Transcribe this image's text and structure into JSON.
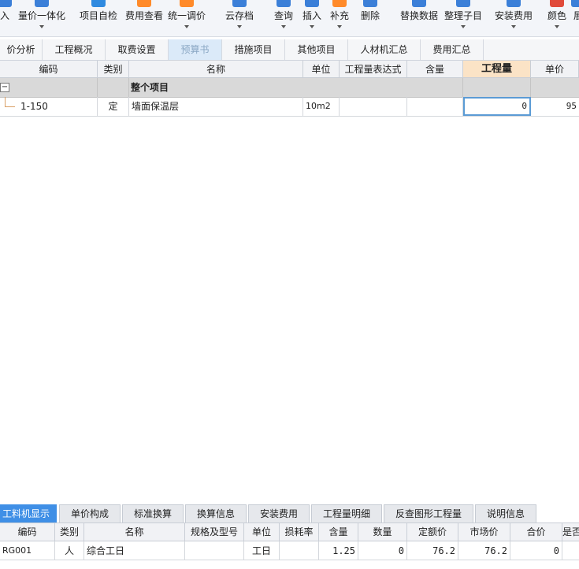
{
  "toolbar": {
    "buttons": [
      {
        "label": "入",
        "icon": "import-icon",
        "color": "#3b7fd8"
      },
      {
        "label": "量价一体化",
        "icon": "quantity-price-icon",
        "color": "#3b7fd8"
      },
      {
        "label": "项目自检",
        "icon": "self-check-icon",
        "color": "#2f8ae0"
      },
      {
        "label": "费用查看",
        "icon": "fee-view-icon",
        "color": "#ff8a2a"
      },
      {
        "label": "统一调价",
        "icon": "price-adjust-icon",
        "color": "#ff8a2a"
      },
      {
        "label": "云存档",
        "icon": "cloud-archive-icon",
        "color": "#3b7fd8"
      },
      {
        "label": "查询",
        "icon": "query-icon",
        "color": "#3b7fd8"
      },
      {
        "label": "插入",
        "icon": "insert-icon",
        "color": "#3b7fd8"
      },
      {
        "label": "补充",
        "icon": "supplement-icon",
        "color": "#ff8a2a"
      },
      {
        "label": "删除",
        "icon": "delete-icon",
        "color": "#3b7fd8"
      },
      {
        "label": "替换数据",
        "icon": "replace-data-icon",
        "color": "#3b7fd8"
      },
      {
        "label": "整理子目",
        "icon": "organize-items-icon",
        "color": "#3b7fd8"
      },
      {
        "label": "安装费用",
        "icon": "install-fee-icon",
        "color": "#3b7fd8"
      },
      {
        "label": "颜色",
        "icon": "color-icon",
        "color": "#e04a3a"
      },
      {
        "label": "展",
        "icon": "expand-icon",
        "color": "#3b7fd8"
      }
    ]
  },
  "main_tabs": [
    "价分析",
    "工程概况",
    "取费设置",
    "预算书",
    "措施项目",
    "其他项目",
    "人材机汇总",
    "费用汇总"
  ],
  "main_active_tab": "预算书",
  "budget_table": {
    "headers": [
      "编码",
      "类别",
      "名称",
      "单位",
      "工程量表达式",
      "含量",
      "工程量",
      "单价"
    ],
    "group_row": {
      "toggle": "−",
      "name": "整个项目"
    },
    "rows": [
      {
        "code": "1-150",
        "type": "定",
        "name": "墙面保温层",
        "unit": "10m2",
        "expression": "",
        "content": "",
        "quantity": "0",
        "unit_price": "95"
      }
    ]
  },
  "bottom_tabs": [
    "工料机显示",
    "单价构成",
    "标准换算",
    "换算信息",
    "安装费用",
    "工程量明细",
    "反查图形工程量",
    "说明信息"
  ],
  "bottom_active_tab": "工料机显示",
  "resource_table": {
    "headers": [
      "编码",
      "类别",
      "名称",
      "规格及型号",
      "单位",
      "损耗率",
      "含量",
      "数量",
      "定额价",
      "市场价",
      "合价",
      "是否"
    ],
    "rows": [
      {
        "code": "RG001",
        "type": "人",
        "name": "综合工日",
        "spec": "",
        "unit": "工日",
        "loss": "",
        "content": "1.25",
        "qty": "0",
        "quota_price": "76.2",
        "market_price": "76.2",
        "total": "0",
        "flag": ""
      }
    ]
  }
}
